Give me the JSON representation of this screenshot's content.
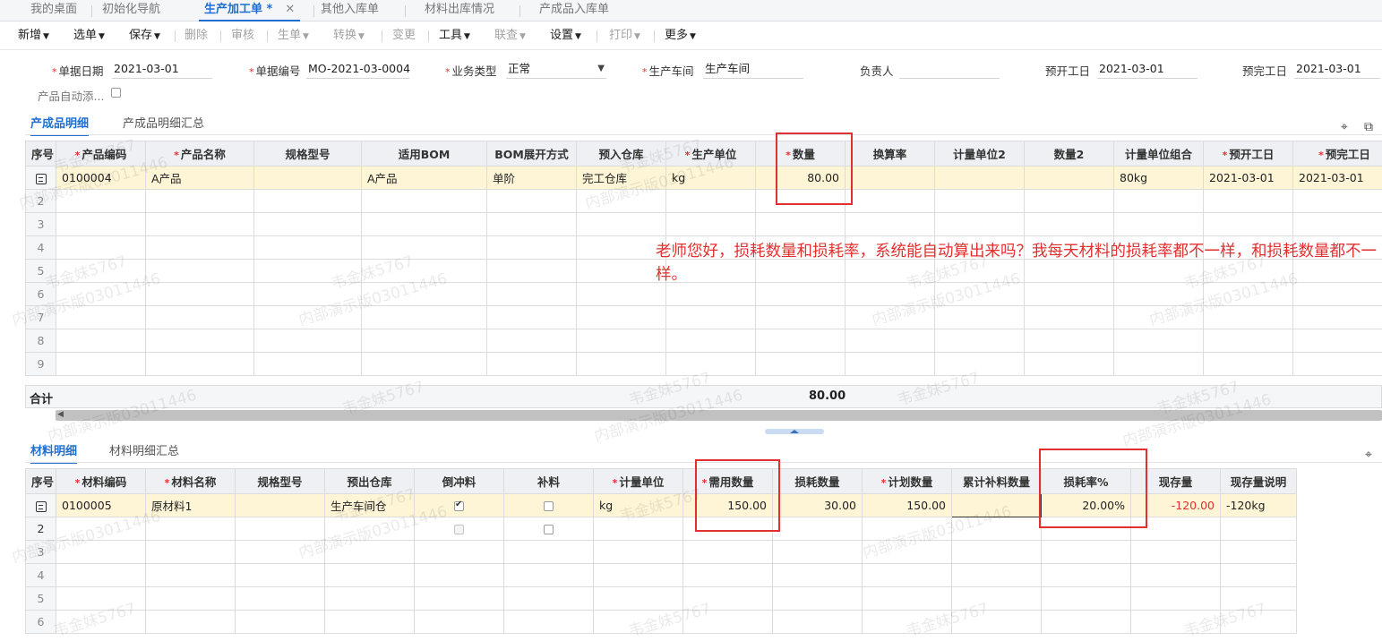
{
  "tabs": [
    {
      "label": "我的桌面",
      "active": false
    },
    {
      "label": "初始化导航",
      "active": false
    },
    {
      "label": "生产加工单 *",
      "active": true
    },
    {
      "label": "其他入库单",
      "active": false
    },
    {
      "label": "材料出库情况",
      "active": false
    },
    {
      "label": "产成品入库单",
      "active": false
    }
  ],
  "tab_close": "✕",
  "toolbar": [
    {
      "label": "新增",
      "caret": true,
      "enabled": true
    },
    {
      "label": "选单",
      "caret": true,
      "enabled": true
    },
    {
      "label": "保存",
      "caret": true,
      "enabled": true
    },
    {
      "label": "删除",
      "caret": false,
      "enabled": false
    },
    {
      "label": "审核",
      "caret": false,
      "enabled": false
    },
    {
      "label": "生单",
      "caret": true,
      "enabled": false
    },
    {
      "label": "转换",
      "caret": true,
      "enabled": false
    },
    {
      "label": "变更",
      "caret": false,
      "enabled": false
    },
    {
      "label": "工具",
      "caret": true,
      "enabled": true
    },
    {
      "label": "联查",
      "caret": true,
      "enabled": false
    },
    {
      "label": "设置",
      "caret": true,
      "enabled": true
    },
    {
      "label": "打印",
      "caret": true,
      "enabled": false
    },
    {
      "label": "更多",
      "caret": true,
      "enabled": true
    }
  ],
  "header": {
    "doc_date_label": "单据日期",
    "doc_date": "2021-03-01",
    "doc_no_label": "单据编号",
    "doc_no": "MO-2021-03-0004",
    "biz_type_label": "业务类型",
    "biz_type": "正常",
    "workshop_label": "生产车间",
    "workshop": "生产车间",
    "owner_label": "负责人",
    "owner": "",
    "plan_start_label": "预开工日",
    "plan_start": "2021-03-01",
    "plan_end_label": "预完工日",
    "plan_end": "2021-03-01",
    "auto_add_label": "产品自动添..."
  },
  "product_section": {
    "tab_detail": "产成品明细",
    "tab_summary": "产成品明细汇总",
    "columns": [
      "序号",
      "产品编码",
      "产品名称",
      "规格型号",
      "适用BOM",
      "BOM展开方式",
      "预入仓库",
      "生产单位",
      "数量",
      "换算率",
      "计量单位2",
      "数量2",
      "计量单位组合",
      "预开工日",
      "预完工日"
    ],
    "rows": [
      {
        "code": "0100004",
        "name": "A产品",
        "spec": "",
        "bom": "A产品",
        "bom_mode": "单阶",
        "warehouse": "完工仓库",
        "unit": "kg",
        "qty": "80.00",
        "rate": "",
        "unit2": "",
        "qty2": "",
        "unit_combo": "80kg",
        "start": "2021-03-01",
        "end": "2021-03-01"
      }
    ],
    "row_numbers": [
      "2",
      "3",
      "4",
      "5",
      "6",
      "7",
      "8",
      "9"
    ],
    "total_label": "合计",
    "total_qty": "80.00"
  },
  "material_section": {
    "tab_detail": "材料明细",
    "tab_summary": "材料明细汇总",
    "columns": [
      "序号",
      "材料编码",
      "材料名称",
      "规格型号",
      "预出仓库",
      "倒冲料",
      "补料",
      "计量单位",
      "需用数量",
      "损耗数量",
      "计划数量",
      "累计补料数量",
      "损耗率%",
      "现存量",
      "现存量说明"
    ],
    "rows": [
      {
        "code": "0100005",
        "name": "原材料1",
        "spec": "",
        "warehouse": "生产车间仓",
        "backflush": true,
        "supplement": false,
        "unit": "kg",
        "need_qty": "150.00",
        "loss_qty": "30.00",
        "plan_qty": "150.00",
        "cum_supp": "",
        "loss_rate": "20.00%",
        "stock": "-120.00",
        "stock_note": "-120kg"
      }
    ],
    "row_numbers": [
      "2",
      "3",
      "4",
      "5",
      "6"
    ]
  },
  "comment": "老师您好，损耗数量和损耗率，系统能自动算出来吗？我每天材料的损耗率都不一样，和损耗数量都不一样。",
  "watermark": {
    "name": "韦金妹5767",
    "demo": "内部演示版03011446"
  }
}
